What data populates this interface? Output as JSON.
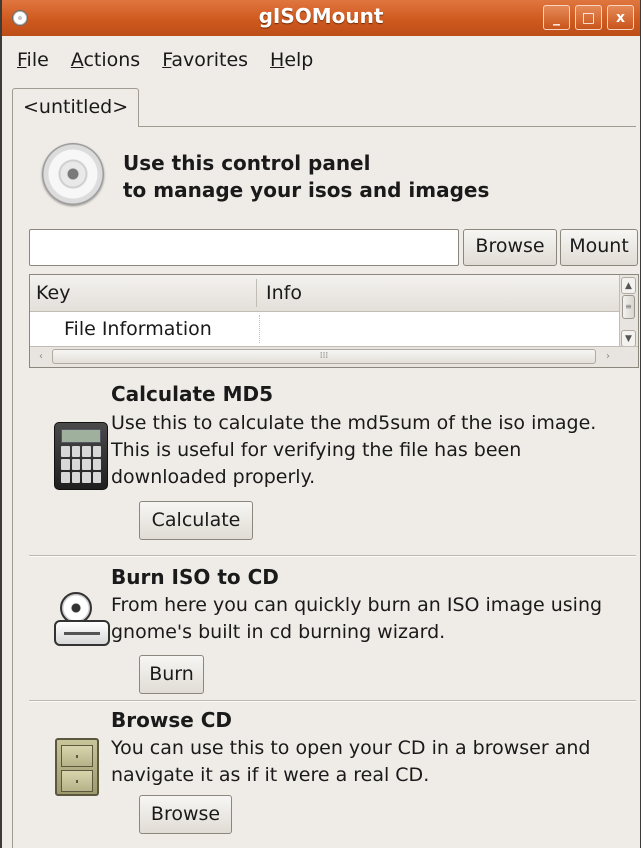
{
  "window": {
    "title": "gISOMount",
    "controls": {
      "minimize": "_",
      "maximize": "□",
      "close": "x"
    }
  },
  "menubar": {
    "items": [
      {
        "mnemonic": "F",
        "rest": "ile"
      },
      {
        "mnemonic": "A",
        "rest": "ctions"
      },
      {
        "mnemonic": "F",
        "rest": "avorites"
      },
      {
        "mnemonic": "H",
        "rest": "elp"
      }
    ]
  },
  "tab": {
    "label": "<untitled>"
  },
  "header": {
    "line1": "Use this control panel",
    "line2": "to manage your isos and images"
  },
  "path_input": {
    "value": ""
  },
  "buttons": {
    "browse": "Browse",
    "mount": "Mount"
  },
  "tree": {
    "columns": [
      "Key",
      "Info"
    ],
    "rows": [
      {
        "key": "File Information",
        "info": ""
      }
    ]
  },
  "sections": [
    {
      "title": "Calculate MD5",
      "desc": "Use this to calculate the md5sum of the iso image.  This is useful for verifying the file has been downloaded properly.",
      "button": "Calculate"
    },
    {
      "title": "Burn ISO to CD",
      "desc": "From here you can quickly burn an ISO image using gnome's built in cd burning wizard.",
      "button": "Burn"
    },
    {
      "title": "Browse CD",
      "desc": "You can use this to open your CD in a browser and navigate it as if it were a real CD.",
      "button": "Browse"
    }
  ],
  "colors": {
    "titlebar": "#d9632a",
    "window_bg": "#efebe7"
  }
}
